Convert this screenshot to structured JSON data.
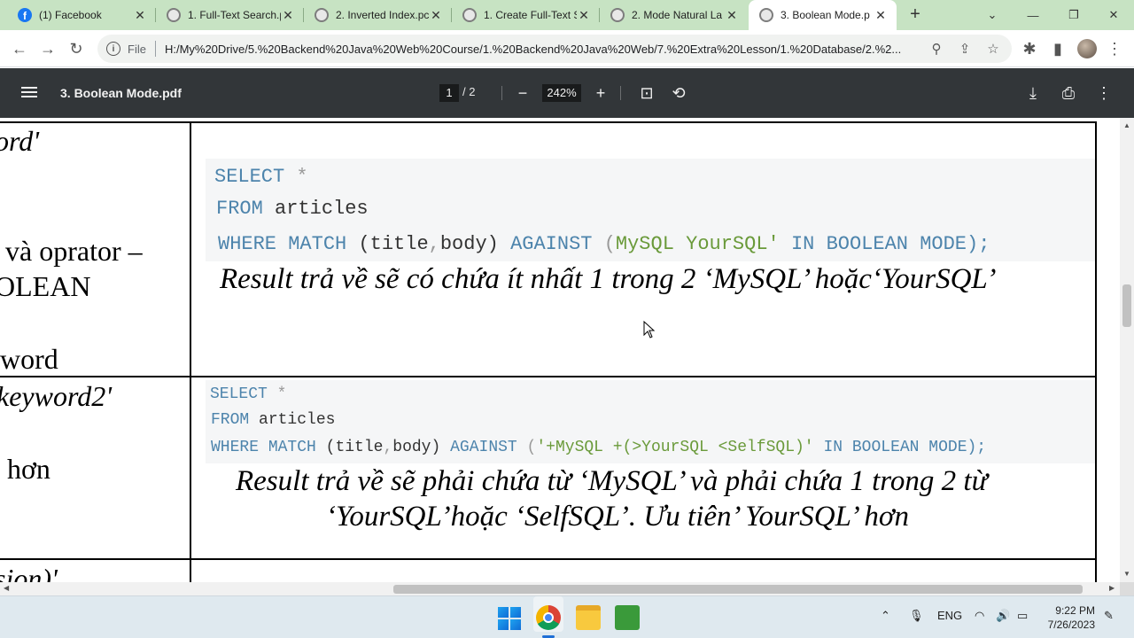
{
  "browser": {
    "tabs": [
      {
        "title": "(1) Facebook",
        "icon": "facebook-icon",
        "active": false
      },
      {
        "title": "1. Full-Text Search.p",
        "icon": "globe-icon",
        "active": false
      },
      {
        "title": "2. Inverted Index.pc",
        "icon": "globe-icon",
        "active": false
      },
      {
        "title": "1. Create Full-Text S",
        "icon": "globe-icon",
        "active": false
      },
      {
        "title": "2. Mode Natural La",
        "icon": "globe-icon",
        "active": false
      },
      {
        "title": "3. Boolean Mode.p",
        "icon": "globe-icon",
        "active": true
      }
    ],
    "new_tab": "+",
    "address": {
      "scheme_label": "File",
      "url": "H:/My%20Drive/5.%20Backend%20Java%20Web%20Course/1.%20Backend%20Java%20Web/7.%20Extra%20Lesson/1.%20Database/2.%2..."
    }
  },
  "pdf": {
    "title": "3. Boolean Mode.pdf",
    "page_current": "1",
    "page_total": "/ 2",
    "zoom": "242%"
  },
  "document": {
    "left_column": [
      {
        "text": "ord'",
        "italic": true
      },
      {
        "text": "và oprator  –",
        "italic": false
      },
      {
        "text": "OLEAN",
        "italic": false
      },
      {
        "text": "word",
        "italic": false
      },
      {
        "text": "keyword2'",
        "italic": true
      },
      {
        "text": "hơn",
        "italic": false
      },
      {
        "text": "sion)'",
        "italic": true
      }
    ],
    "example1": {
      "line1": [
        "SELECT",
        "*"
      ],
      "line2": [
        "FROM",
        "articles"
      ],
      "line3": [
        "WHERE",
        "MATCH",
        "(title",
        ",",
        "body)",
        "AGAINST",
        "(",
        "MySQL YourSQL'",
        "IN",
        "BOOLEAN",
        "MODE);"
      ],
      "result": "Result trả về sẽ có chứa ít nhất 1 trong 2 ‘MySQL’ hoặc‘YourSQL’"
    },
    "example2": {
      "line1": [
        "SELECT",
        "*"
      ],
      "line2": [
        "FROM",
        "articles"
      ],
      "line3": [
        "WHERE",
        "MATCH",
        "(title",
        ",",
        "body)",
        "AGAINST",
        "(",
        "'+MySQL +(>YourSQL <SelfSQL)'",
        "IN",
        "BOOLEAN",
        "MODE);"
      ],
      "result_line1": "Result trả về sẽ phải chứa từ ‘MySQL’ và phải chứa 1 trong 2 từ",
      "result_line2": "‘YourSQL’hoặc ‘SelfSQL’. Ưu tiên’ YourSQL’ hơn"
    }
  },
  "taskbar": {
    "language": "ENG",
    "time": "9:22 PM",
    "date": "7/26/2023"
  },
  "colors": {
    "tabstrip": "#c7e3c3",
    "pdf_toolbar": "#323639",
    "sql_keyword": "#4d84ac",
    "sql_string": "#6a9a3a"
  }
}
